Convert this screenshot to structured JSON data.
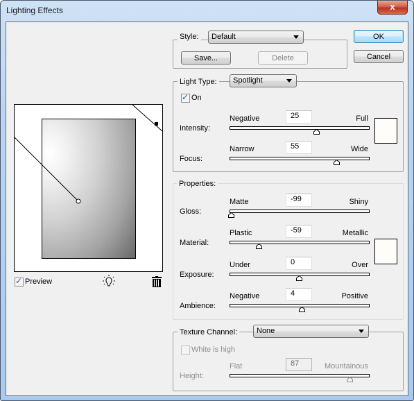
{
  "window": {
    "title": "Lighting Effects",
    "close_glyph": "x"
  },
  "buttons": {
    "ok": "OK",
    "cancel": "Cancel"
  },
  "style_group": {
    "label": "Style:",
    "selected": "Default",
    "save": "Save...",
    "delete": "Delete"
  },
  "light_group": {
    "type_label": "Light Type:",
    "type_selected": "Spotlight",
    "on_label": "On",
    "on_checked": true,
    "color_swatch": "#fffdfa",
    "sliders": [
      {
        "label": "Intensity:",
        "min_label": "Negative",
        "max_label": "Full",
        "value": "25",
        "min": -100,
        "max": 100
      },
      {
        "label": "Focus:",
        "min_label": "Narrow",
        "max_label": "Wide",
        "value": "55",
        "min": -100,
        "max": 100
      }
    ]
  },
  "properties_group": {
    "legend": "Properties:",
    "color_swatch": "#ffffff",
    "sliders": [
      {
        "label": "Gloss:",
        "min_label": "Matte",
        "max_label": "Shiny",
        "value": "-99",
        "min": -100,
        "max": 100
      },
      {
        "label": "Material:",
        "min_label": "Plastic",
        "max_label": "Metallic",
        "value": "-59",
        "min": -100,
        "max": 100
      },
      {
        "label": "Exposure:",
        "min_label": "Under",
        "max_label": "Over",
        "value": "0",
        "min": -100,
        "max": 100
      },
      {
        "label": "Ambience:",
        "min_label": "Negative",
        "max_label": "Positive",
        "value": "4",
        "min": -100,
        "max": 100
      }
    ]
  },
  "texture_group": {
    "label": "Texture Channel:",
    "selected": "None",
    "white_is_high_label": "White is high",
    "white_is_high_checked": false,
    "height_slider": {
      "label": "Height:",
      "min_label": "Flat",
      "max_label": "Mountainous",
      "value": "87",
      "min": 0,
      "max": 100
    }
  },
  "preview": {
    "checkbox_label": "Preview",
    "checked": true,
    "check_glyph": "✓"
  }
}
